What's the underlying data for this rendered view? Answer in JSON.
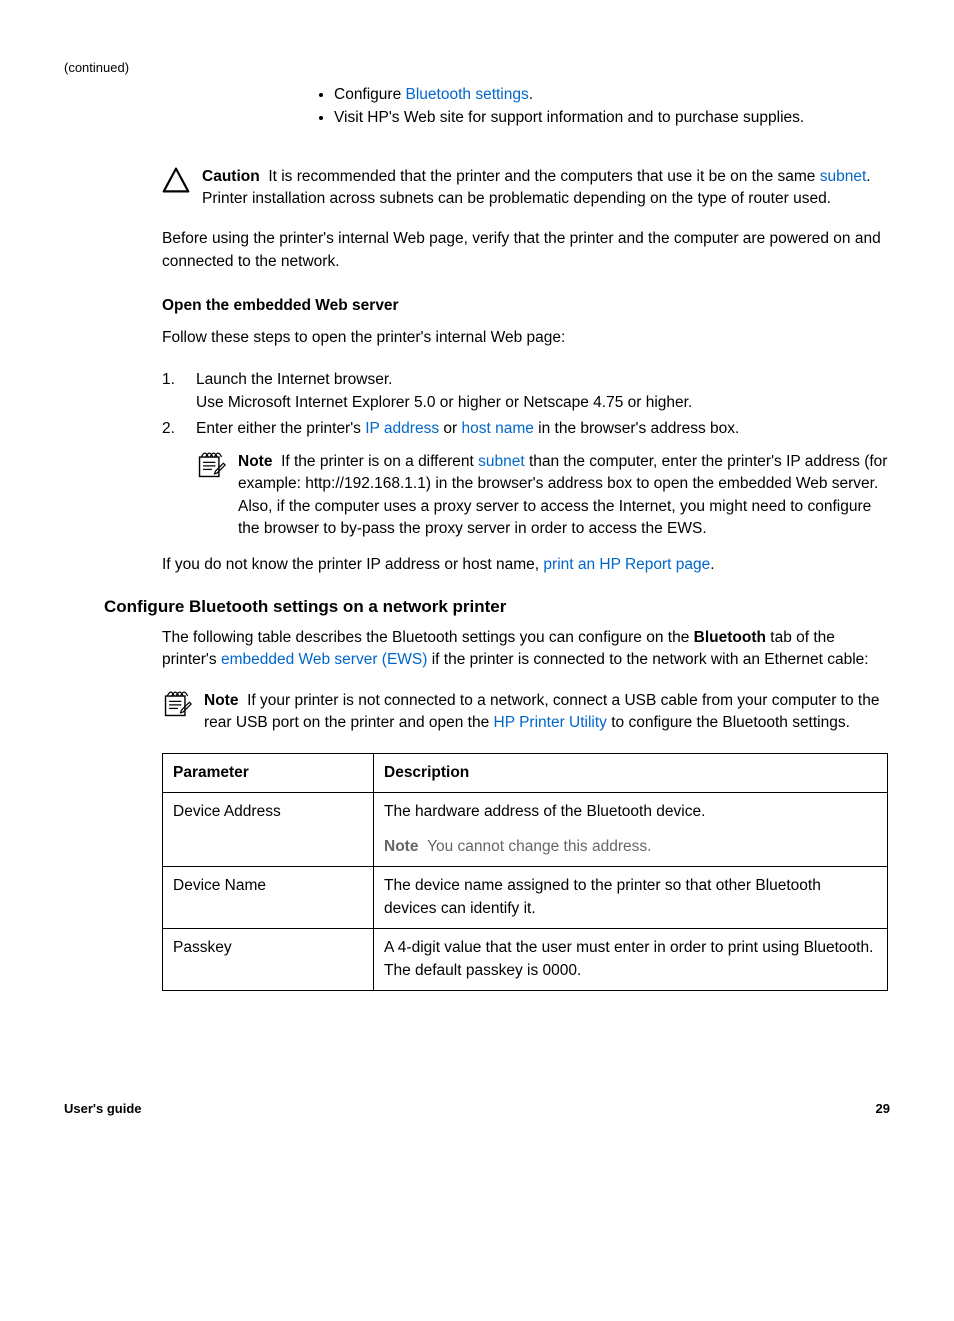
{
  "continued": "(continued)",
  "topBullets": [
    {
      "prefix": "Configure ",
      "link": "Bluetooth settings",
      "suffix": "."
    },
    {
      "plain": "Visit HP's Web site for support information and to purchase supplies."
    }
  ],
  "caution": {
    "label": "Caution",
    "pre": "It is recommended that the printer and the computers that use it be on the same ",
    "link": "subnet",
    "post": ". Printer installation across subnets can be problematic depending on the type of router used."
  },
  "beforePara": "Before using the printer's internal Web page, verify that the printer and the computer are powered on and connected to the network.",
  "openHeading": "Open the embedded Web server",
  "followPara": "Follow these steps to open the printer's internal Web page:",
  "steps": {
    "one": {
      "num": "1.",
      "line1": "Launch the Internet browser.",
      "line2": "Use Microsoft Internet Explorer 5.0 or higher or Netscape 4.75 or higher."
    },
    "two": {
      "num": "2.",
      "pre": "Enter either the printer's ",
      "link1": "IP address",
      "mid": " or ",
      "link2": "host name",
      "post": " in the browser's address box."
    }
  },
  "innerNote": {
    "label": "Note",
    "pre": "If the printer is on a different ",
    "link": "subnet",
    "post": " than the computer, enter the printer's IP address (for example: http://192.168.1.1) in the browser's address box to open the embedded Web server. Also, if the computer uses a proxy server to access the Internet, you might need to configure the browser to by-pass the proxy server in order to access the EWS."
  },
  "ifNotKnow": {
    "pre": "If you do not know the printer IP address or host name, ",
    "link": "print an HP Report page",
    "post": "."
  },
  "sectionHeading": "Configure Bluetooth settings on a network printer",
  "sectionPara": {
    "pre": "The following table describes the Bluetooth settings you can configure on the ",
    "bold": "Bluetooth",
    "mid": " tab of the printer's ",
    "link": "embedded Web server (EWS)",
    "post": " if the printer is connected to the network with an Ethernet cable:"
  },
  "sectionNote": {
    "label": "Note",
    "pre": "If your printer is not connected to a network, connect a USB cable from your computer to the rear USB port on the printer and open the ",
    "link": "HP Printer Utility",
    "post": " to configure the Bluetooth settings."
  },
  "table": {
    "headParam": "Parameter",
    "headDesc": "Description",
    "rows": [
      {
        "param": "Device Address",
        "desc1": "The hardware address of the Bluetooth device.",
        "noteLabel": "Note",
        "noteText": "You cannot change this address."
      },
      {
        "param": "Device Name",
        "desc1": "The device name assigned to the printer so that other Bluetooth devices can identify it."
      },
      {
        "param": "Passkey",
        "desc1": "A 4-digit value that the user must enter in order to print using Bluetooth. The default passkey is 0000."
      }
    ]
  },
  "footerLeft": "User's guide",
  "footerRight": "29"
}
